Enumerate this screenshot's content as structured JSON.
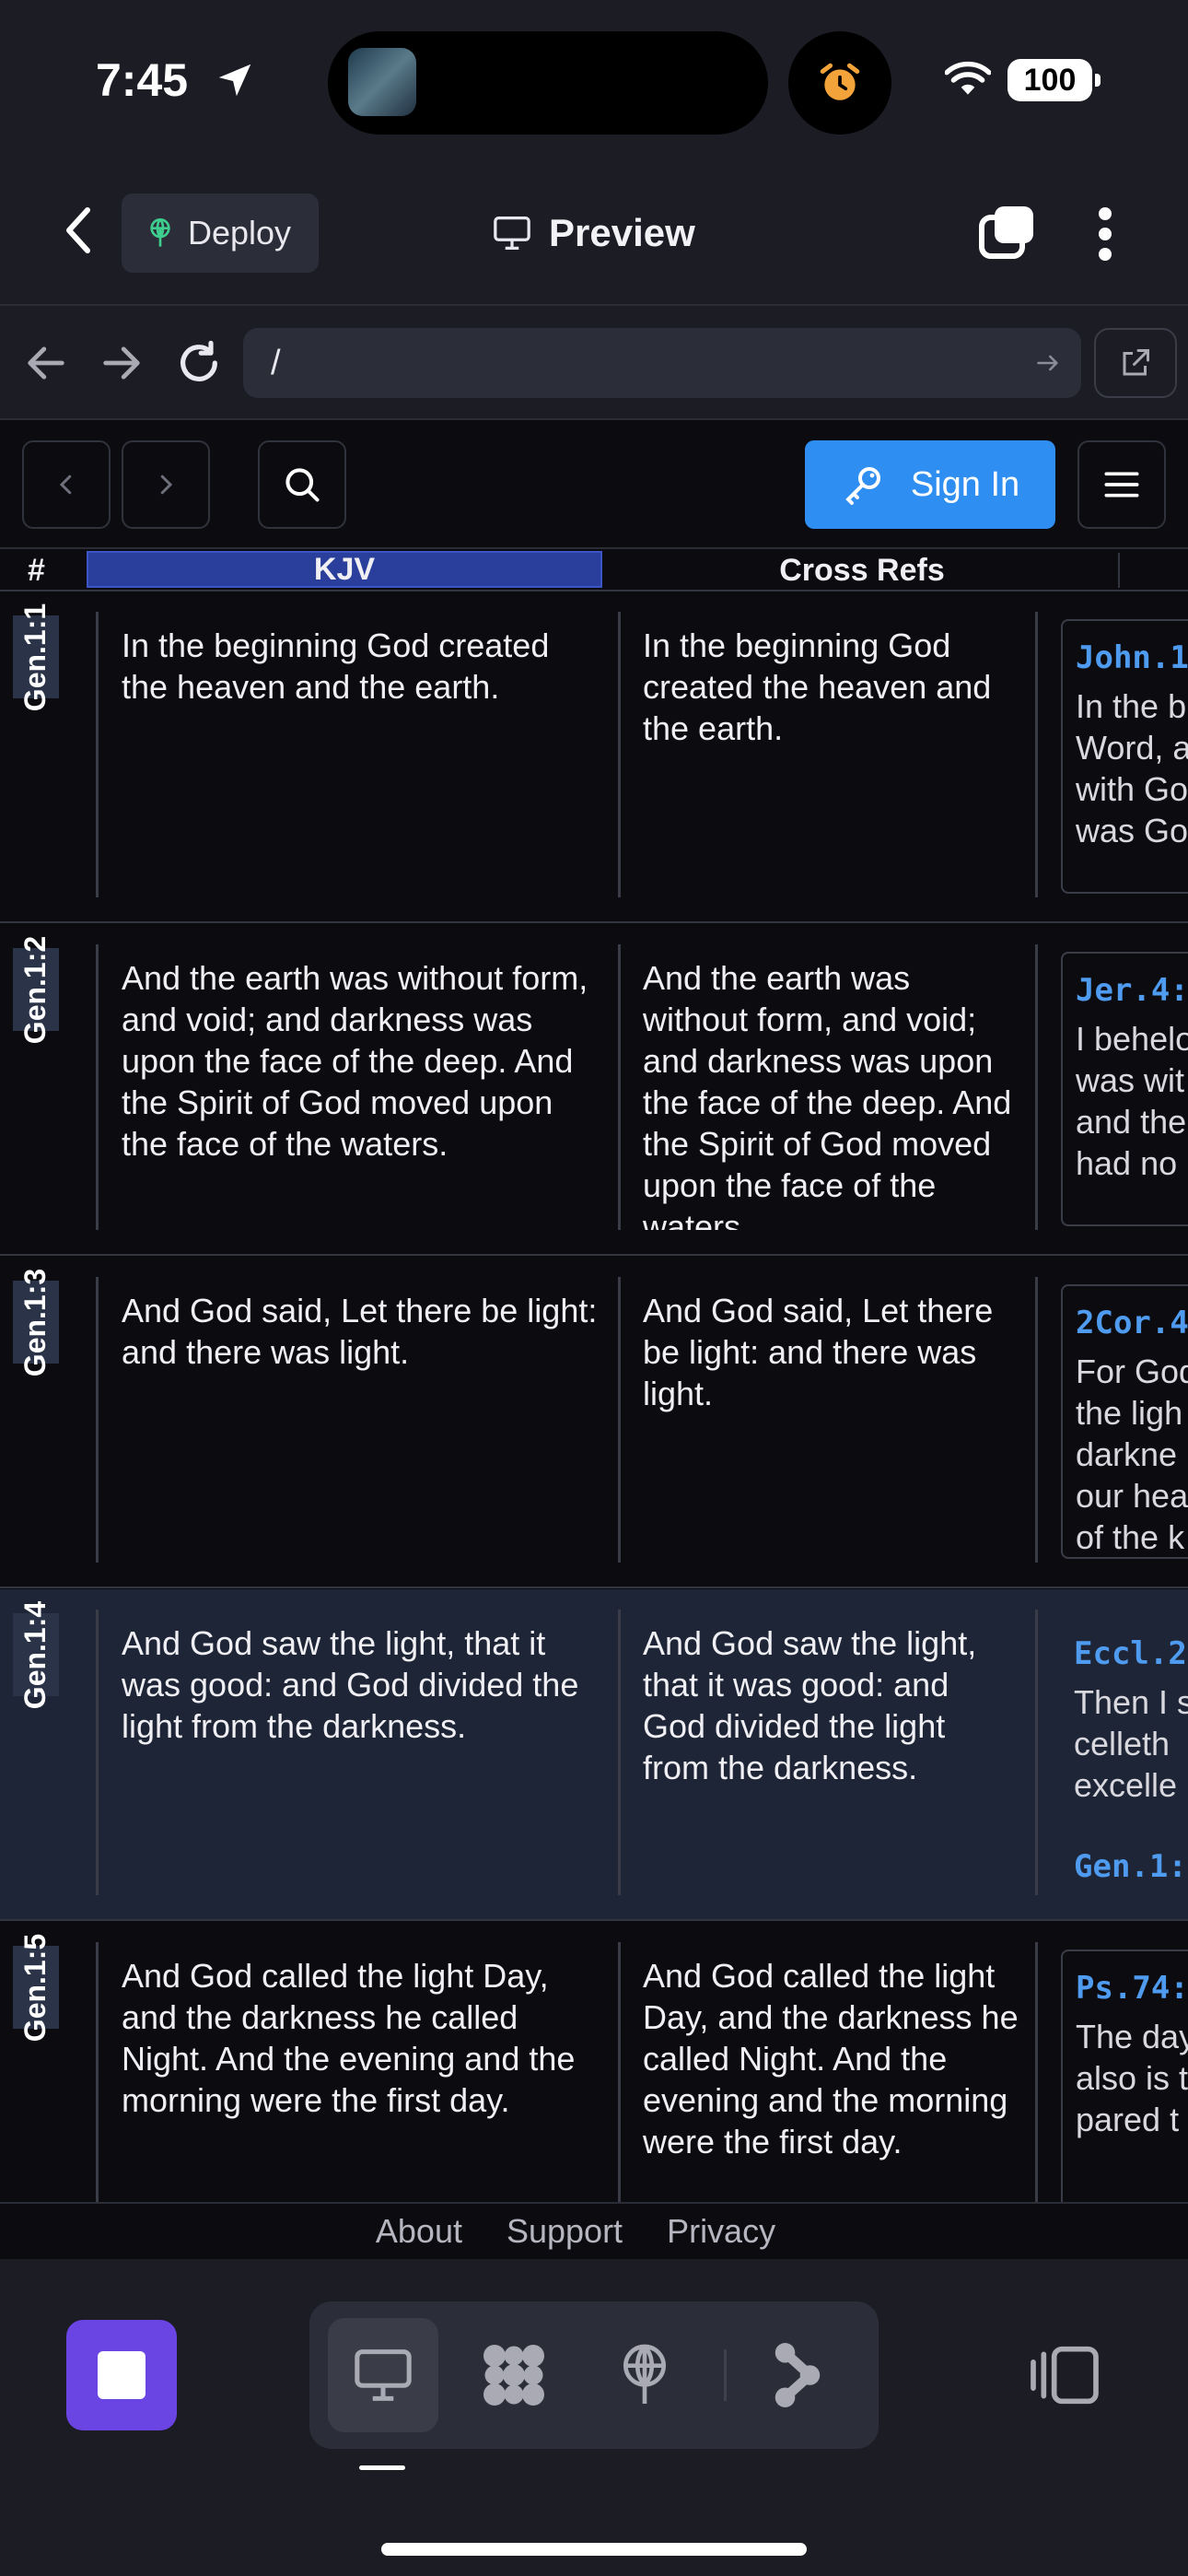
{
  "status_bar": {
    "time": "7:45",
    "battery": "100"
  },
  "header": {
    "deploy_label": "Deploy",
    "title": "Preview"
  },
  "browser": {
    "url": "/"
  },
  "toolbar": {
    "sign_in_label": "Sign In"
  },
  "table": {
    "headers": {
      "index": "#",
      "kjv": "KJV",
      "cross_refs": "Cross Refs"
    },
    "rows": [
      {
        "ref": "Gen.1:1",
        "kjv": "In the beginning God created the heaven and the earth.",
        "kjv2": "In the beginning God created the heaven and the earth.",
        "xref": "John.1",
        "xref_text": "In the b\nWord, a\nwith Go\nwas Go",
        "xref2": ""
      },
      {
        "ref": "Gen.1:2",
        "kjv": "And the earth was without form, and void; and darkness was upon the face of the deep. And the Spirit of God moved upon the face of the waters.",
        "kjv2": "And the earth was without form, and void; and darkness was upon the face of the deep. And the Spirit of God moved upon the face of the waters.",
        "xref": "Jer.4:",
        "xref_text": "I behelo\nwas wit\nand the\nhad no",
        "xref2": ""
      },
      {
        "ref": "Gen.1:3",
        "kjv": "And God said, Let there be light: and there was light.",
        "kjv2": "And God said, Let there be light: and there was light.",
        "xref": "2Cor.4",
        "xref_text": "For God\nthe ligh\ndarkne\nour hea\nof the k",
        "xref2": ""
      },
      {
        "ref": "Gen.1:4",
        "kjv": "And God saw the light, that it was good: and God divided the light from the darkness.",
        "kjv2": "And God saw the light, that it was good: and God divided the light from the darkness.",
        "xref": "Eccl.2",
        "xref_text": "Then I s\ncelleth\nexcelle",
        "xref2": "Gen.1:"
      },
      {
        "ref": "Gen.1:5",
        "kjv": "And God called the light Day, and the darkness he called Night. And the evening and the morning were the first day.",
        "kjv2": "And God called the light Day, and the darkness he called Night. And the evening and the morning were the first day.",
        "xref": "Ps.74:",
        "xref_text": "The day\nalso is t\npared t",
        "xref2": ""
      }
    ]
  },
  "footer": {
    "links": [
      "About",
      "Support",
      "Privacy"
    ]
  },
  "colors": {
    "accent_blue": "#2f8ef2",
    "stop_purple": "#6a45e4",
    "kjv_header": "#2a3f9c",
    "xref_link": "#4e9bf0"
  }
}
